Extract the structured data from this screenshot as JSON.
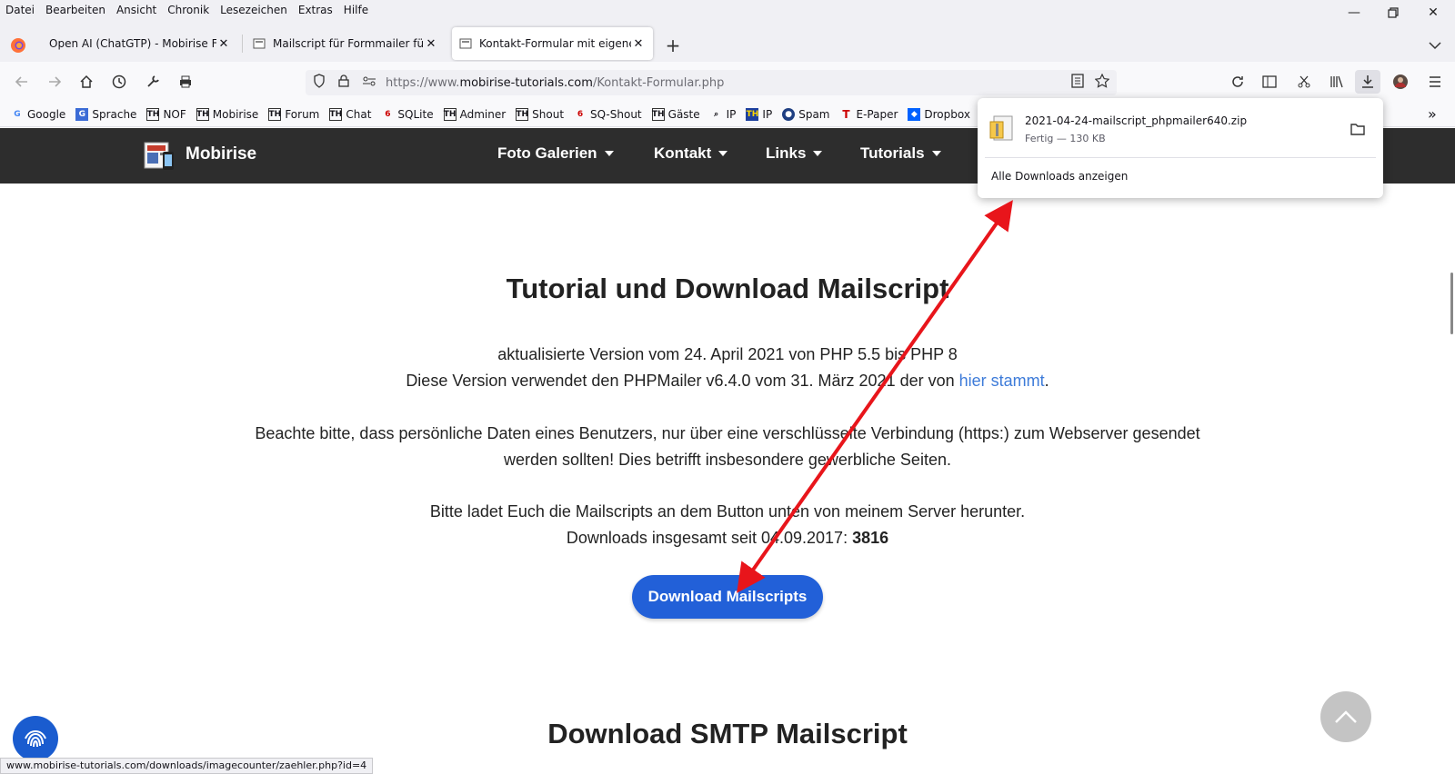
{
  "menubar": {
    "items": [
      "Datei",
      "Bearbeiten",
      "Ansicht",
      "Chronik",
      "Lesezeichen",
      "Extras",
      "Hilfe"
    ]
  },
  "tabs": [
    {
      "label": "Open AI (ChatGTP) - Mobirise Forum"
    },
    {
      "label": "Mailscript für Formmailer für PHP"
    },
    {
      "label": "Kontakt-Formular mit eigenem"
    }
  ],
  "url": {
    "scheme": "https://www.",
    "host": "mobirise-tutorials.com",
    "path": "/Kontakt-Formular.php"
  },
  "bookmarks": [
    "Google",
    "Sprache",
    "NOF",
    "Mobirise",
    "Forum",
    "Chat",
    "SQLite",
    "Adminer",
    "Shout",
    "SQ-Shout",
    "Gäste",
    "IP",
    "IP",
    "Spam",
    "E-Paper",
    "Dropbox"
  ],
  "download_panel": {
    "filename": "2021-04-24-mailscript_phpmailer640.zip",
    "status": "Fertig — 130 KB",
    "show_all": "Alle Downloads anzeigen"
  },
  "site": {
    "brand": "Mobirise",
    "nav": [
      "Foto Galerien",
      "Kontakt",
      "Links",
      "Tutorials"
    ]
  },
  "content": {
    "heading1": "Tutorial und Download Mailscript",
    "line1": "aktualisierte Version vom 24. April 2021 von PHP 5.5 bis PHP 8",
    "line2_pre": "Diese Version verwendet den PHPMailer v6.4.0 vom 31. März 2021 der von ",
    "line2_link": "hier stammt",
    "line2_post": ".",
    "line3": "Beachte bitte, dass persönliche Daten eines Benutzers, nur über eine verschlüsselte Verbindung (https:) zum Webserver gesendet",
    "line4": "werden sollten! Dies betrifft insbesondere gewerbliche Seiten.",
    "line5": "Bitte ladet Euch die Mailscripts an dem Button unten von meinem Server herunter.",
    "line6_pre": "Downloads insgesamt seit 04.09.2017: ",
    "line6_count": "3816",
    "button": "Download Mailscripts",
    "heading2": "Download SMTP Mailscript"
  },
  "status_url": "www.mobirise-tutorials.com/downloads/imagecounter/zaehler.php?id=4"
}
